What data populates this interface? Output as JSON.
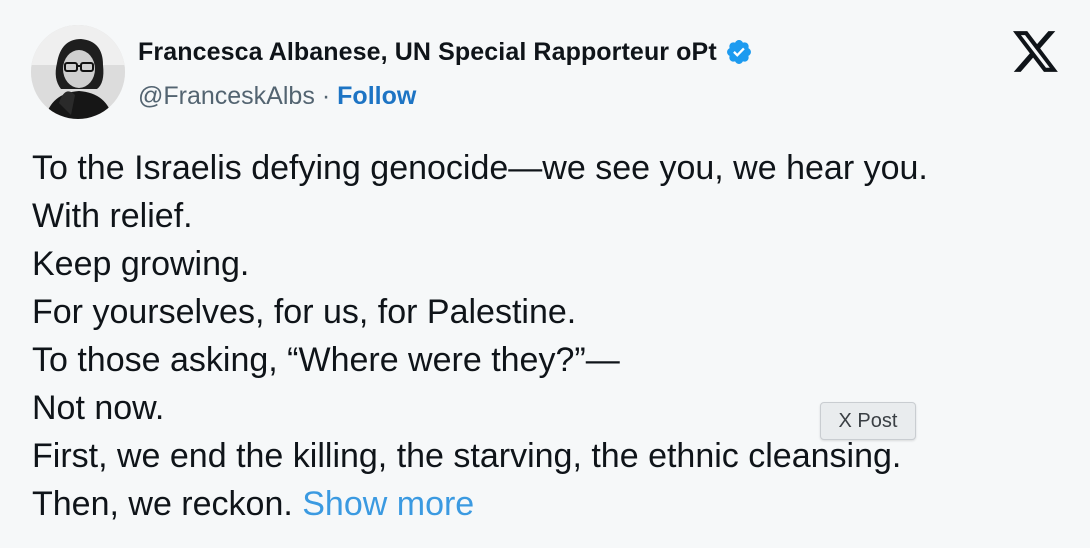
{
  "author": {
    "display_name": "Francesca Albanese, UN Special Rapporteur oPt",
    "handle": "@FranceskAlbs",
    "separator": "·",
    "follow_label": "Follow",
    "verified": true,
    "avatar": "profile-photo"
  },
  "platform": {
    "logo": "x-logo-icon"
  },
  "tweet": {
    "lines": [
      "To the Israelis defying genocide—we see you, we hear you.",
      "With relief.",
      "Keep growing.",
      "For yourselves, for us, for Palestine.",
      "To those asking, “Where were they?”—",
      "Not now.",
      "First, we end the killing, the starving, the ethnic cleansing.",
      "Then, we reckon."
    ],
    "show_more_label": "Show more"
  },
  "tooltip": {
    "label": "X Post"
  },
  "colors": {
    "background": "#f6f8f9",
    "text": "#0f1419",
    "secondary_text": "#536471",
    "follow": "#1d74c4",
    "show_more": "#3b9ae1",
    "verified_badge": "#1d9bf0"
  }
}
